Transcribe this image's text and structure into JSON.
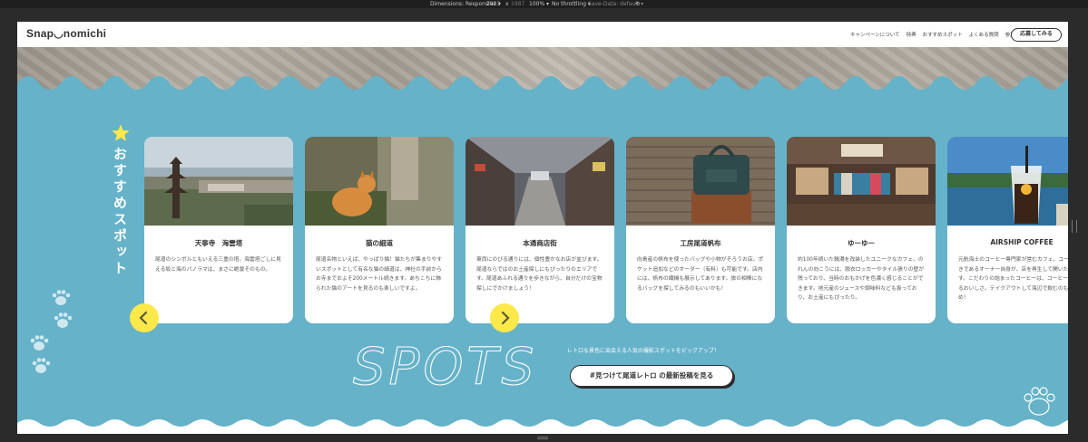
{
  "devtools": {
    "dimensions": "Dimensions: Responsive ▾",
    "width": "2823",
    "x": "x",
    "dpr": "1987",
    "zoom": "100% ▾",
    "throttle": "No throttling ▾",
    "save_data": "Save-Data: default ▾"
  },
  "header": {
    "logo": "Snap◡nomichi",
    "nav": [
      "キャンペーンについて",
      "特典",
      "おすすめスポット",
      "よくある質問",
      "参加要項"
    ],
    "cta": "応募してみる"
  },
  "section": {
    "title": "おすすめスポット",
    "spots_word": "SPOTS",
    "lead": "レトロな景色に出会える人気の撮影スポットをピックアップ！",
    "button": "#見つけて尾道レトロ の最新投稿を見る"
  },
  "cards": [
    {
      "name": "天寧寺　海雲塔",
      "desc": "尾道のシンボルともいえる三重の塔。海雲塔ごしに見える坂と海のパノラマは、まさに絶景そのもの。"
    },
    {
      "name": "猫の細道",
      "desc": "尾道名物といえば、やっぱり猫！猫たちが集まりやすいスポットとして有名な猫の細道は、神社の手前からお寺までおよそ200メートル続きます。あちこちに飾られた猫のアートを見るのも楽しいですよ。"
    },
    {
      "name": "本通商店街",
      "desc": "東西にのびる通りには、個性豊かなお店が並びます。尾道ならではのお土産探しにもぴったりのエリアです。尾道あふれる通りを歩きながら、自分だけの宝物探しにでかけましょう！"
    },
    {
      "name": "工房尾道帆布",
      "desc": "向島産の帆布を使ったバッグや小物がそろうお店。ポケット追加などのオーダー（有料）も可能です。店内には、帆布の織機も展示してあります。旅の相棒になるバッグを探してみるのもいいかも！"
    },
    {
      "name": "ゆーゆー",
      "desc": "約100年続いた銭湯を改装したユニークなカフェ。のれんの向こうには、脱衣ロッカーやタイル張りの壁が残っており、当時のおもかげを色濃く感じることができます。地元産のジュースや調味料なども扱っており、お土産にもぴったり。"
    },
    {
      "name": "AIRSHIP COFFEE",
      "desc": "元航海士のコーヒー専門家が営むカフェ。コーヒー好きであるオーナー自身が、店を再生して開いたお店です。こだわりの詰まったコーヒーは、コーヒー通も唸るおいしさ。テイクアウトして海辺で飲むのもおすすめ！"
    }
  ],
  "icons": {
    "star": "star-icon",
    "prev": "chevron-left-icon",
    "next": "chevron-right-icon",
    "paw": "paw-icon",
    "stamp": "paw-stamp-icon"
  },
  "colors": {
    "section_bg": "#66b2c9",
    "accent_yellow": "#ffe84a",
    "text_dark": "#333333"
  }
}
